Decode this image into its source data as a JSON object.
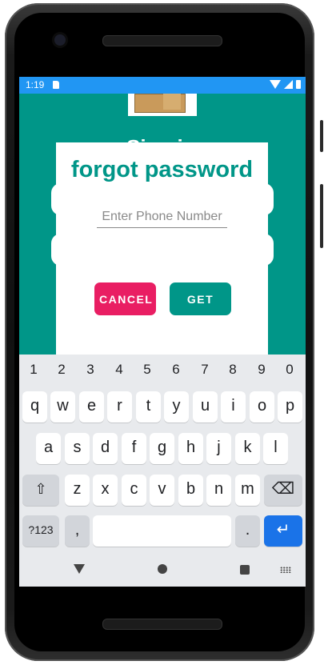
{
  "status": {
    "time": "1:19"
  },
  "background": {
    "partial_text": "Sign in"
  },
  "dialog": {
    "title": "forgot password",
    "phone_placeholder": "Enter Phone Number",
    "cancel_label": "CANCEL",
    "get_label": "GET"
  },
  "keyboard": {
    "numbers": [
      "1",
      "2",
      "3",
      "4",
      "5",
      "6",
      "7",
      "8",
      "9",
      "0"
    ],
    "row1": [
      "q",
      "w",
      "e",
      "r",
      "t",
      "y",
      "u",
      "i",
      "o",
      "p"
    ],
    "row2": [
      "a",
      "s",
      "d",
      "f",
      "g",
      "h",
      "j",
      "k",
      "l"
    ],
    "row3": [
      "z",
      "x",
      "c",
      "v",
      "b",
      "n",
      "m"
    ],
    "symbols_label": "?123",
    "comma_label": ",",
    "period_label": ".",
    "shift_glyph": "⇧",
    "backspace_glyph": "⌫",
    "enter_glyph": "↵"
  },
  "colors": {
    "primary": "#009688",
    "accent": "#E91E63",
    "statusbar": "#2196F3"
  },
  "icons": [
    "sd-card-icon",
    "wifi-icon",
    "signal-icon",
    "battery-icon",
    "back-icon",
    "home-icon",
    "recents-icon",
    "keyboard-switch-icon",
    "shift-icon",
    "backspace-icon",
    "enter-icon"
  ]
}
